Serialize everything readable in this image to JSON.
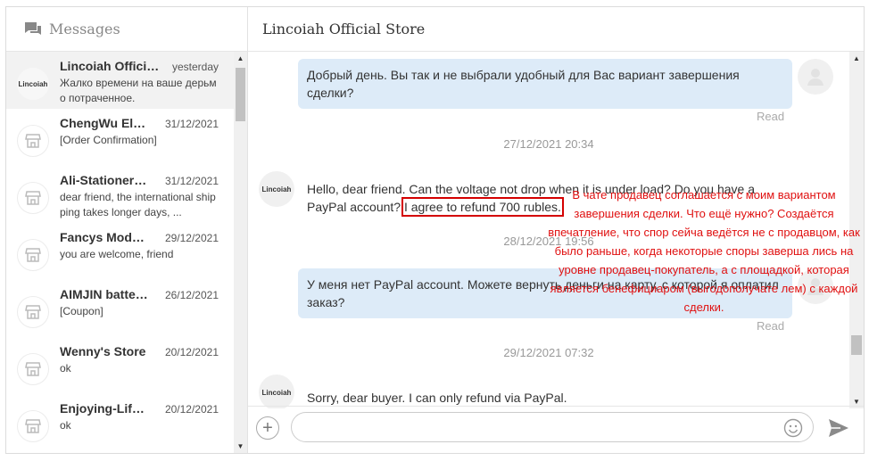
{
  "sidebar": {
    "title": "Messages",
    "conversations": [
      {
        "name": "Lincoiah Offici…",
        "date": "yesterday",
        "preview": "Жалко времени на ваше дерьмо потраченное.",
        "avatar_text": "Lincoiah"
      },
      {
        "name": "ChengWu El…",
        "date": "31/12/2021",
        "preview": "[Order Confirmation]"
      },
      {
        "name": "Ali-Stationer…",
        "date": "31/12/2021",
        "preview": "dear friend, the international shipping takes longer days, ..."
      },
      {
        "name": "Fancys Mod…",
        "date": "29/12/2021",
        "preview": "you are welcome, friend"
      },
      {
        "name": "AIMJIN batte…",
        "date": "26/12/2021",
        "preview": "[Coupon]"
      },
      {
        "name": "Wenny's Store",
        "date": "20/12/2021",
        "preview": "ok"
      },
      {
        "name": "Enjoying-Lif…",
        "date": "20/12/2021",
        "preview": "ok"
      }
    ]
  },
  "chat": {
    "store_name": "Lincoiah Official Store",
    "avatar_text": "Lincoiah",
    "messages": {
      "m1": "Добрый день. Вы так и не выбрали удобный для Вас вариант завершения сделки?",
      "m1_status": "Read",
      "ts1": "27/12/2021 20:34",
      "m2_part1": "Hello, dear friend. Can the voltage not drop when it is under load? Do you have a PayPal account?",
      "m2_highlight": "I agree to refund 700 rubles.",
      "ts2": "28/12/2021 19:56",
      "m3": "У меня нет PayPal account. Можете вернуть деньги на карту, с которой я оплатил заказ?",
      "m3_status": "Read",
      "ts3": "29/12/2021 07:32",
      "m4": "Sorry, dear buyer. I can only refund via PayPal."
    },
    "input_placeholder": ""
  },
  "annotation": "В чате продавец соглашается с моим вариантом завершения сделки. Что ещё нужно? Создаётся впечатление, что спор сейча ведётся не с продавцом, как было раньше, когда некоторые споры заверша лись на уровне продавец-покупатель, а с площадкой, которая является бенефициаром (выгодополучате лем) с каждой сделки.",
  "icons": {
    "messages": "chat-bubbles-icon",
    "store_avatar": "store-icon",
    "add": "plus-icon",
    "emoji": "smiley-icon",
    "send": "send-icon"
  },
  "colors": {
    "outgoing_bubble": "#ddebf8",
    "annotation": "#e01010",
    "highlight_box": "#d40000"
  }
}
